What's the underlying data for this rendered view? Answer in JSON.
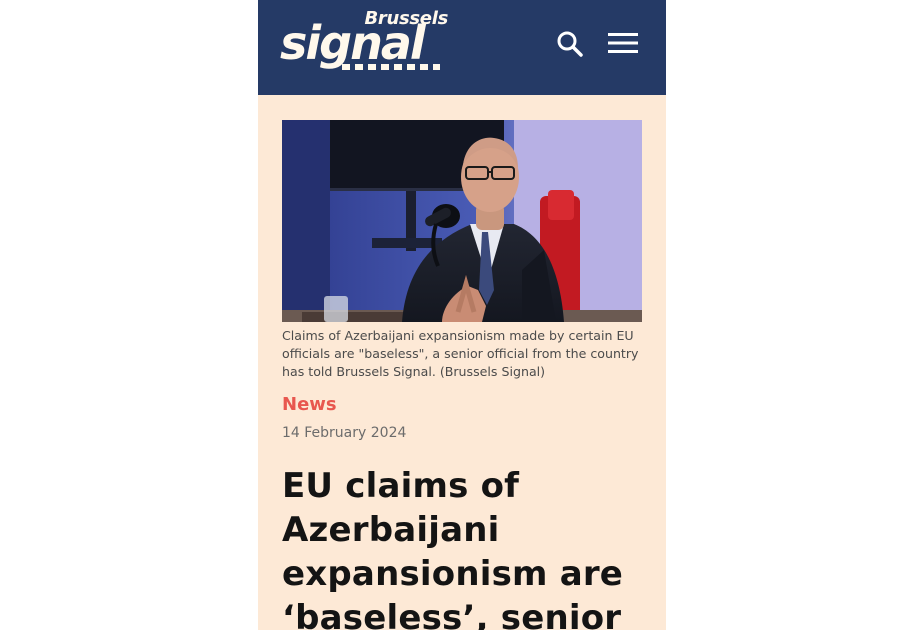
{
  "header": {
    "logo_top": "Brussels",
    "logo_main": "signal",
    "search_icon": "search-icon",
    "menu_icon": "hamburger-menu-icon"
  },
  "colors": {
    "header_bg": "#253a66",
    "page_bg": "#fde9d6",
    "accent": "#e8574f",
    "headline": "#141414"
  },
  "article": {
    "image_alt": "Man in suit speaking into microphone in studio",
    "caption": "Claims of Azerbaijani expansionism made by certain EU officials are \"baseless\", a senior official from the country has told Brussels Signal. (Brussels Signal)",
    "category": "News",
    "date": "14 February 2024",
    "headline": "EU claims of Azerbaijani expansionism are ‘baseless’, senior"
  }
}
